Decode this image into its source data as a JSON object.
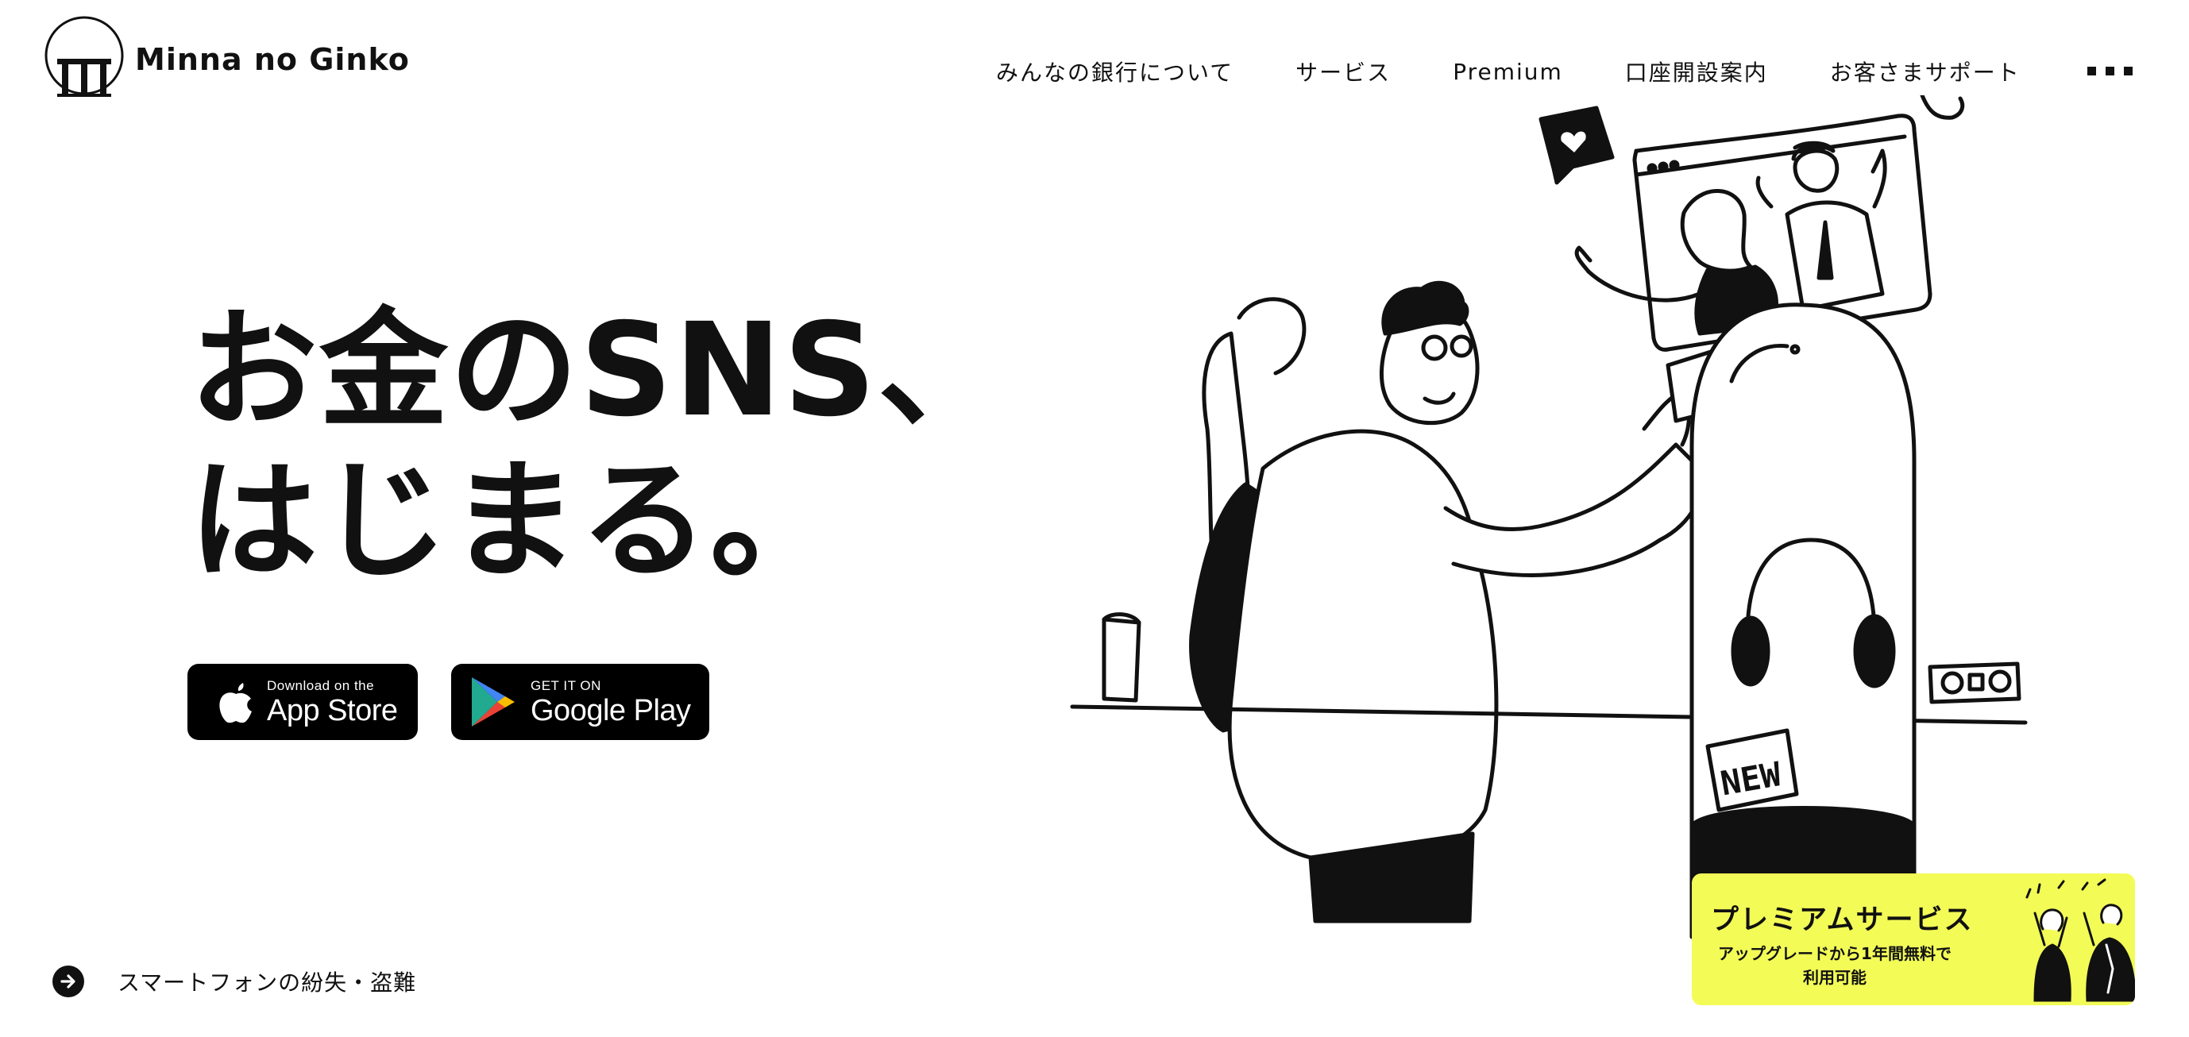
{
  "header": {
    "logo_text": "Minna no Ginko",
    "nav": [
      {
        "label": "みんなの銀行について"
      },
      {
        "label": "サービス"
      },
      {
        "label": "Premium"
      },
      {
        "label": "口座開設案内"
      },
      {
        "label": "お客さまサポート"
      }
    ],
    "more_icon": "ellipsis-icon"
  },
  "hero": {
    "title_line1": "お金のSNS、",
    "title_line2": "はじまる。"
  },
  "stores": {
    "app_store": {
      "small": "Download on the",
      "big": "App Store",
      "icon": "apple-icon"
    },
    "google_play": {
      "small": "GET IT ON",
      "big": "Google Play",
      "icon": "play-icon"
    }
  },
  "notice": {
    "icon": "arrow-right-circle-icon",
    "text": "スマートフォンの紛失・盗難"
  },
  "illustration": {
    "tag_text": "NEW"
  },
  "premium_banner": {
    "title": "プレミアムサービス",
    "subtitle_line1": "アップグレードから1年間無料で",
    "subtitle_line2": "利用可能",
    "background": "#f3fc57"
  },
  "colors": {
    "text": "#111111",
    "background": "#ffffff",
    "accent_yellow": "#f3fc57"
  }
}
